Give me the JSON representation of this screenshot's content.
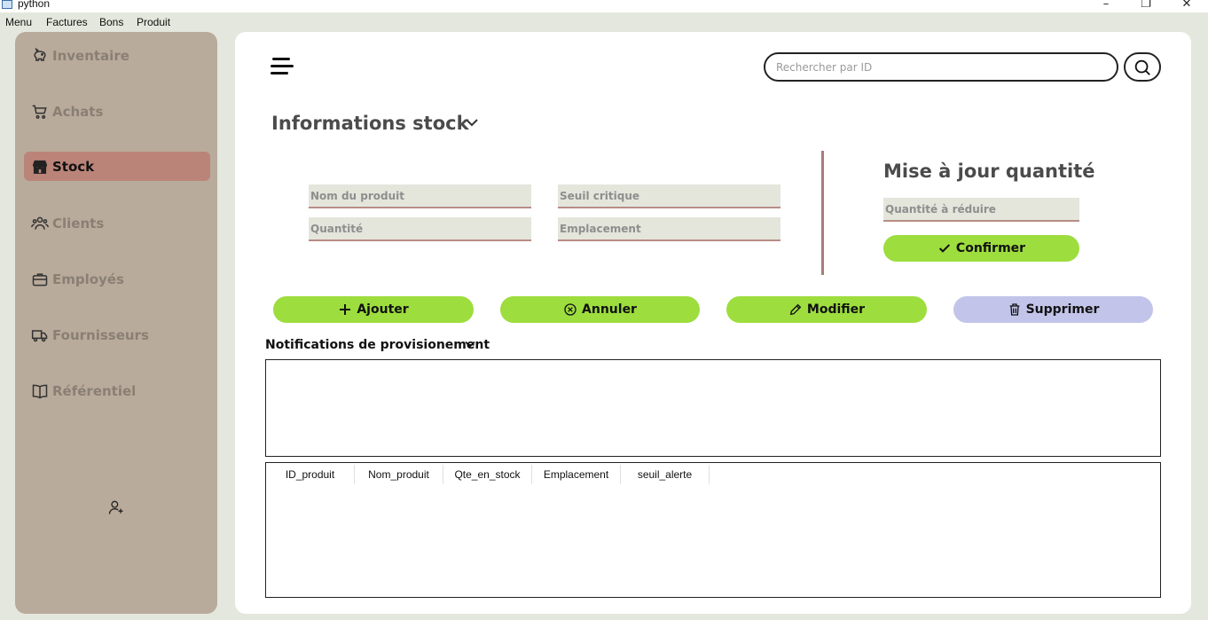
{
  "window": {
    "title": "python",
    "controls": [
      "minimize",
      "maximize",
      "close"
    ]
  },
  "menubar": {
    "items": [
      "Menu",
      "Factures",
      "Bons",
      "Produit"
    ]
  },
  "sidebar": {
    "items": [
      {
        "label": "Inventaire",
        "icon": "piggy-bank-icon",
        "active": false
      },
      {
        "label": "Achats",
        "icon": "cart-icon",
        "active": false
      },
      {
        "label": "Stock",
        "icon": "store-icon",
        "active": true
      },
      {
        "label": "Clients",
        "icon": "users-icon",
        "active": false
      },
      {
        "label": "Employés",
        "icon": "briefcase-icon",
        "active": false
      },
      {
        "label": "Fournisseurs",
        "icon": "truck-icon",
        "active": false
      },
      {
        "label": "Référentiel",
        "icon": "book-icon",
        "active": false
      }
    ],
    "bottom_icon": "add-user-icon"
  },
  "header": {
    "search_placeholder": "Rechercher par ID",
    "search_value": ""
  },
  "stock_form": {
    "title": "Informations stock",
    "fields": {
      "nom_produit": {
        "placeholder": "Nom du produit",
        "value": ""
      },
      "seuil_critique": {
        "placeholder": "Seuil critique",
        "value": ""
      },
      "quantite": {
        "placeholder": "Quantité",
        "value": ""
      },
      "emplacement": {
        "placeholder": "Emplacement",
        "value": ""
      }
    }
  },
  "update_quantity": {
    "title": "Mise à jour quantité",
    "field": {
      "placeholder": "Quantité à réduire",
      "value": ""
    },
    "confirm_label": "Confirmer"
  },
  "actions": {
    "add_label": "Ajouter",
    "cancel_label": "Annuler",
    "edit_label": "Modifier",
    "delete_label": "Supprimer"
  },
  "notifications": {
    "title": "Notifications de provisionement",
    "items": []
  },
  "table": {
    "columns": [
      "ID_produit",
      "Nom_produit",
      "Qte_en_stock",
      "Emplacement",
      "seuil_alerte"
    ],
    "rows": []
  },
  "colors": {
    "background": "#e4e7dd",
    "sidebar": "#b9ab9b",
    "sidebar_active": "#bb8479",
    "accent_green": "#9ddd3e",
    "delete_lavender": "#c3c4e9",
    "field_underline": "#b98c86"
  }
}
